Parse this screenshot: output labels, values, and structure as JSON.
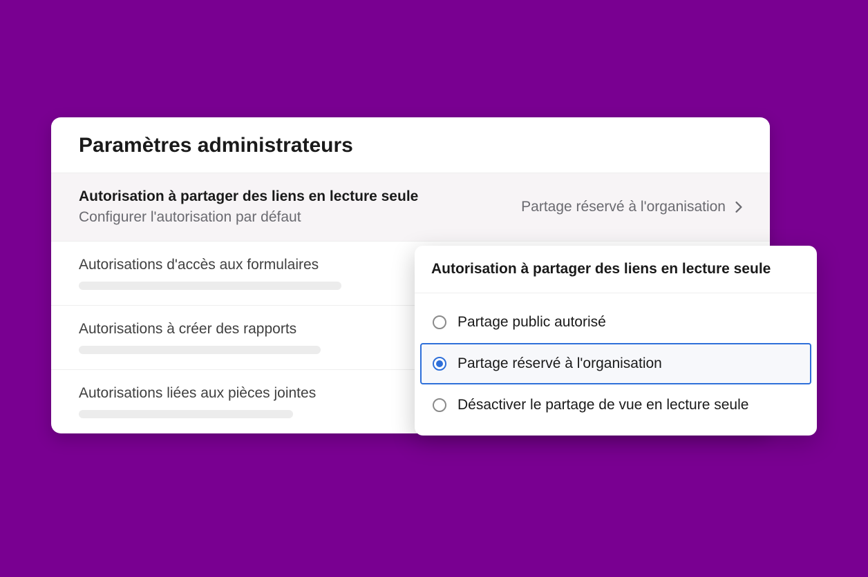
{
  "panel": {
    "title": "Paramètres administrateurs",
    "rows": [
      {
        "title": "Autorisation à partager des liens en lecture seule",
        "subtitle": "Configurer l'autorisation par défaut",
        "value": "Partage réservé à l'organisation"
      },
      {
        "title": "Autorisations d'accès aux formulaires"
      },
      {
        "title": "Autorisations à créer des rapports"
      },
      {
        "title": "Autorisations liées aux pièces jointes"
      }
    ]
  },
  "popover": {
    "title": "Autorisation à partager des liens en lecture seule",
    "options": [
      {
        "label": "Partage public autorisé"
      },
      {
        "label": "Partage réservé à l'organisation"
      },
      {
        "label": "Désactiver le partage de vue en lecture seule"
      }
    ],
    "selectedIndex": 1
  }
}
